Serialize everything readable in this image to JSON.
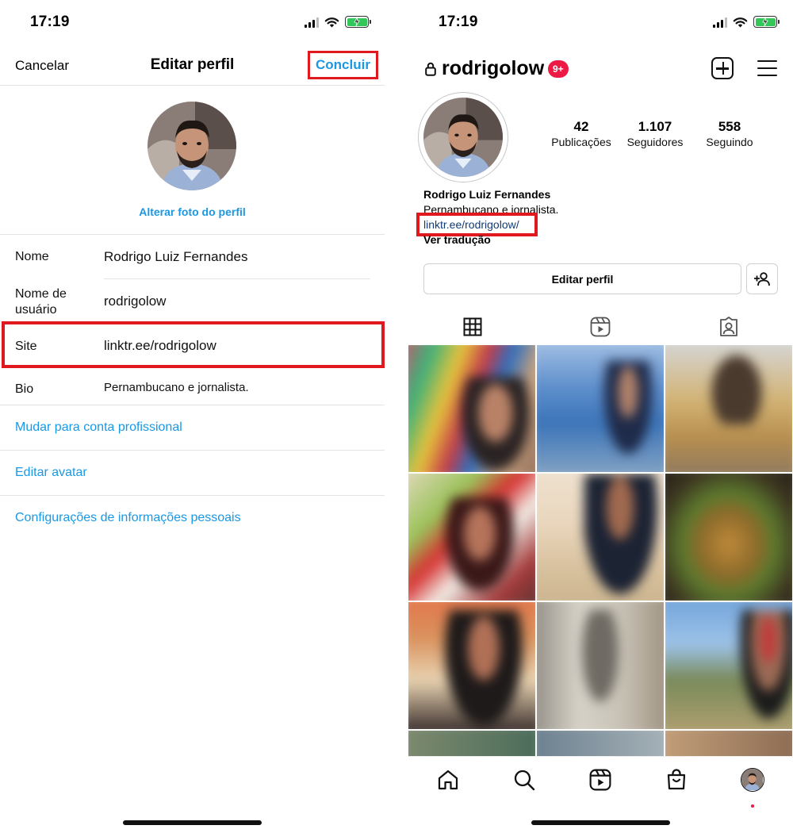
{
  "status_bar": {
    "time_left": "17:19",
    "time_right": "17:19"
  },
  "edit_profile": {
    "cancel_label": "Cancelar",
    "title": "Editar perfil",
    "done_label": "Concluir",
    "change_photo_label": "Alterar foto do perfil",
    "fields": [
      {
        "label": "Nome",
        "value": "Rodrigo Luiz Fernandes"
      },
      {
        "label": "Nome de\nusuário",
        "value": "rodrigolow"
      },
      {
        "label": "Site",
        "value": "linktr.ee/rodrigolow"
      },
      {
        "label": "Bio",
        "value": "Pernambucano e jornalista."
      }
    ],
    "links": [
      "Mudar para conta profissional",
      "Editar avatar",
      "Configurações de informações pessoais"
    ]
  },
  "profile": {
    "username": "rodrigolow",
    "notification_badge": "9+",
    "stats": [
      {
        "value": "42",
        "label": "Publicações"
      },
      {
        "value": "1.107",
        "label": "Seguidores"
      },
      {
        "value": "558",
        "label": "Seguindo"
      }
    ],
    "full_name": "Rodrigo Luiz Fernandes",
    "bio": "Pernambucano e jornalista.",
    "link": "linktr.ee/rodrigolow/",
    "translate_label": "Ver tradução",
    "edit_button_label": "Editar perfil",
    "tabs": [
      "grid-icon",
      "reels-icon",
      "tagged-icon"
    ],
    "nav": [
      "home-icon",
      "search-icon",
      "reels-icon",
      "shop-icon",
      "profile-avatar"
    ]
  },
  "colors": {
    "accent_blue": "#1a98e4",
    "link_dark_blue": "#143b74",
    "highlight_red": "#e0191f",
    "badge_red": "#ee1a46",
    "battery_green": "#32c759"
  }
}
